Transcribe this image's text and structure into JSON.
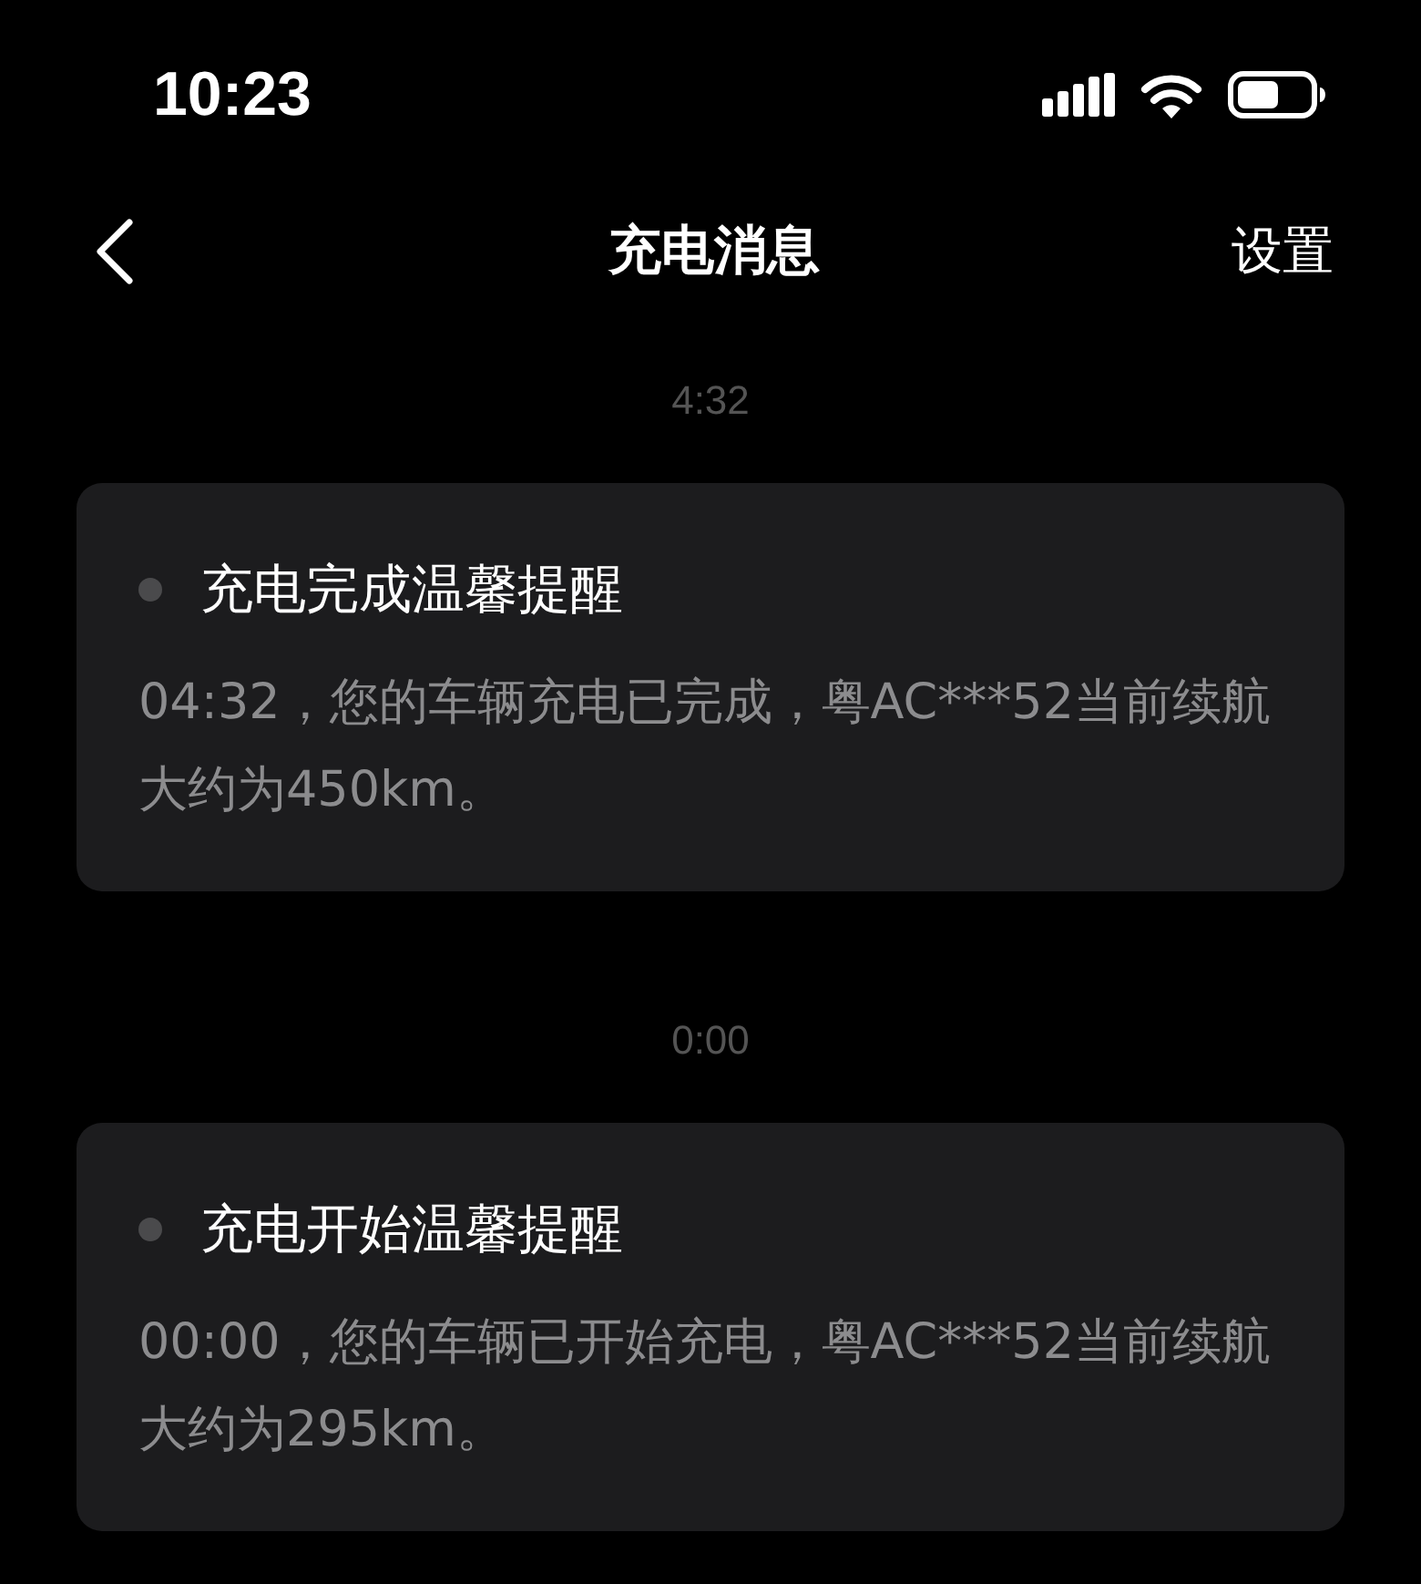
{
  "status_bar": {
    "time": "10:23"
  },
  "nav": {
    "title": "充电消息",
    "action": "设置"
  },
  "messages": [
    {
      "time": "4:32",
      "title": "充电完成温馨提醒",
      "body": "04:32，您的车辆充电已完成，粤AC***52当前续航大约为450km。",
      "read": true
    },
    {
      "time": "0:00",
      "title": "充电开始温馨提醒",
      "body": "00:00，您的车辆已开始充电，粤AC***52当前续航大约为295km。",
      "read": true
    }
  ]
}
